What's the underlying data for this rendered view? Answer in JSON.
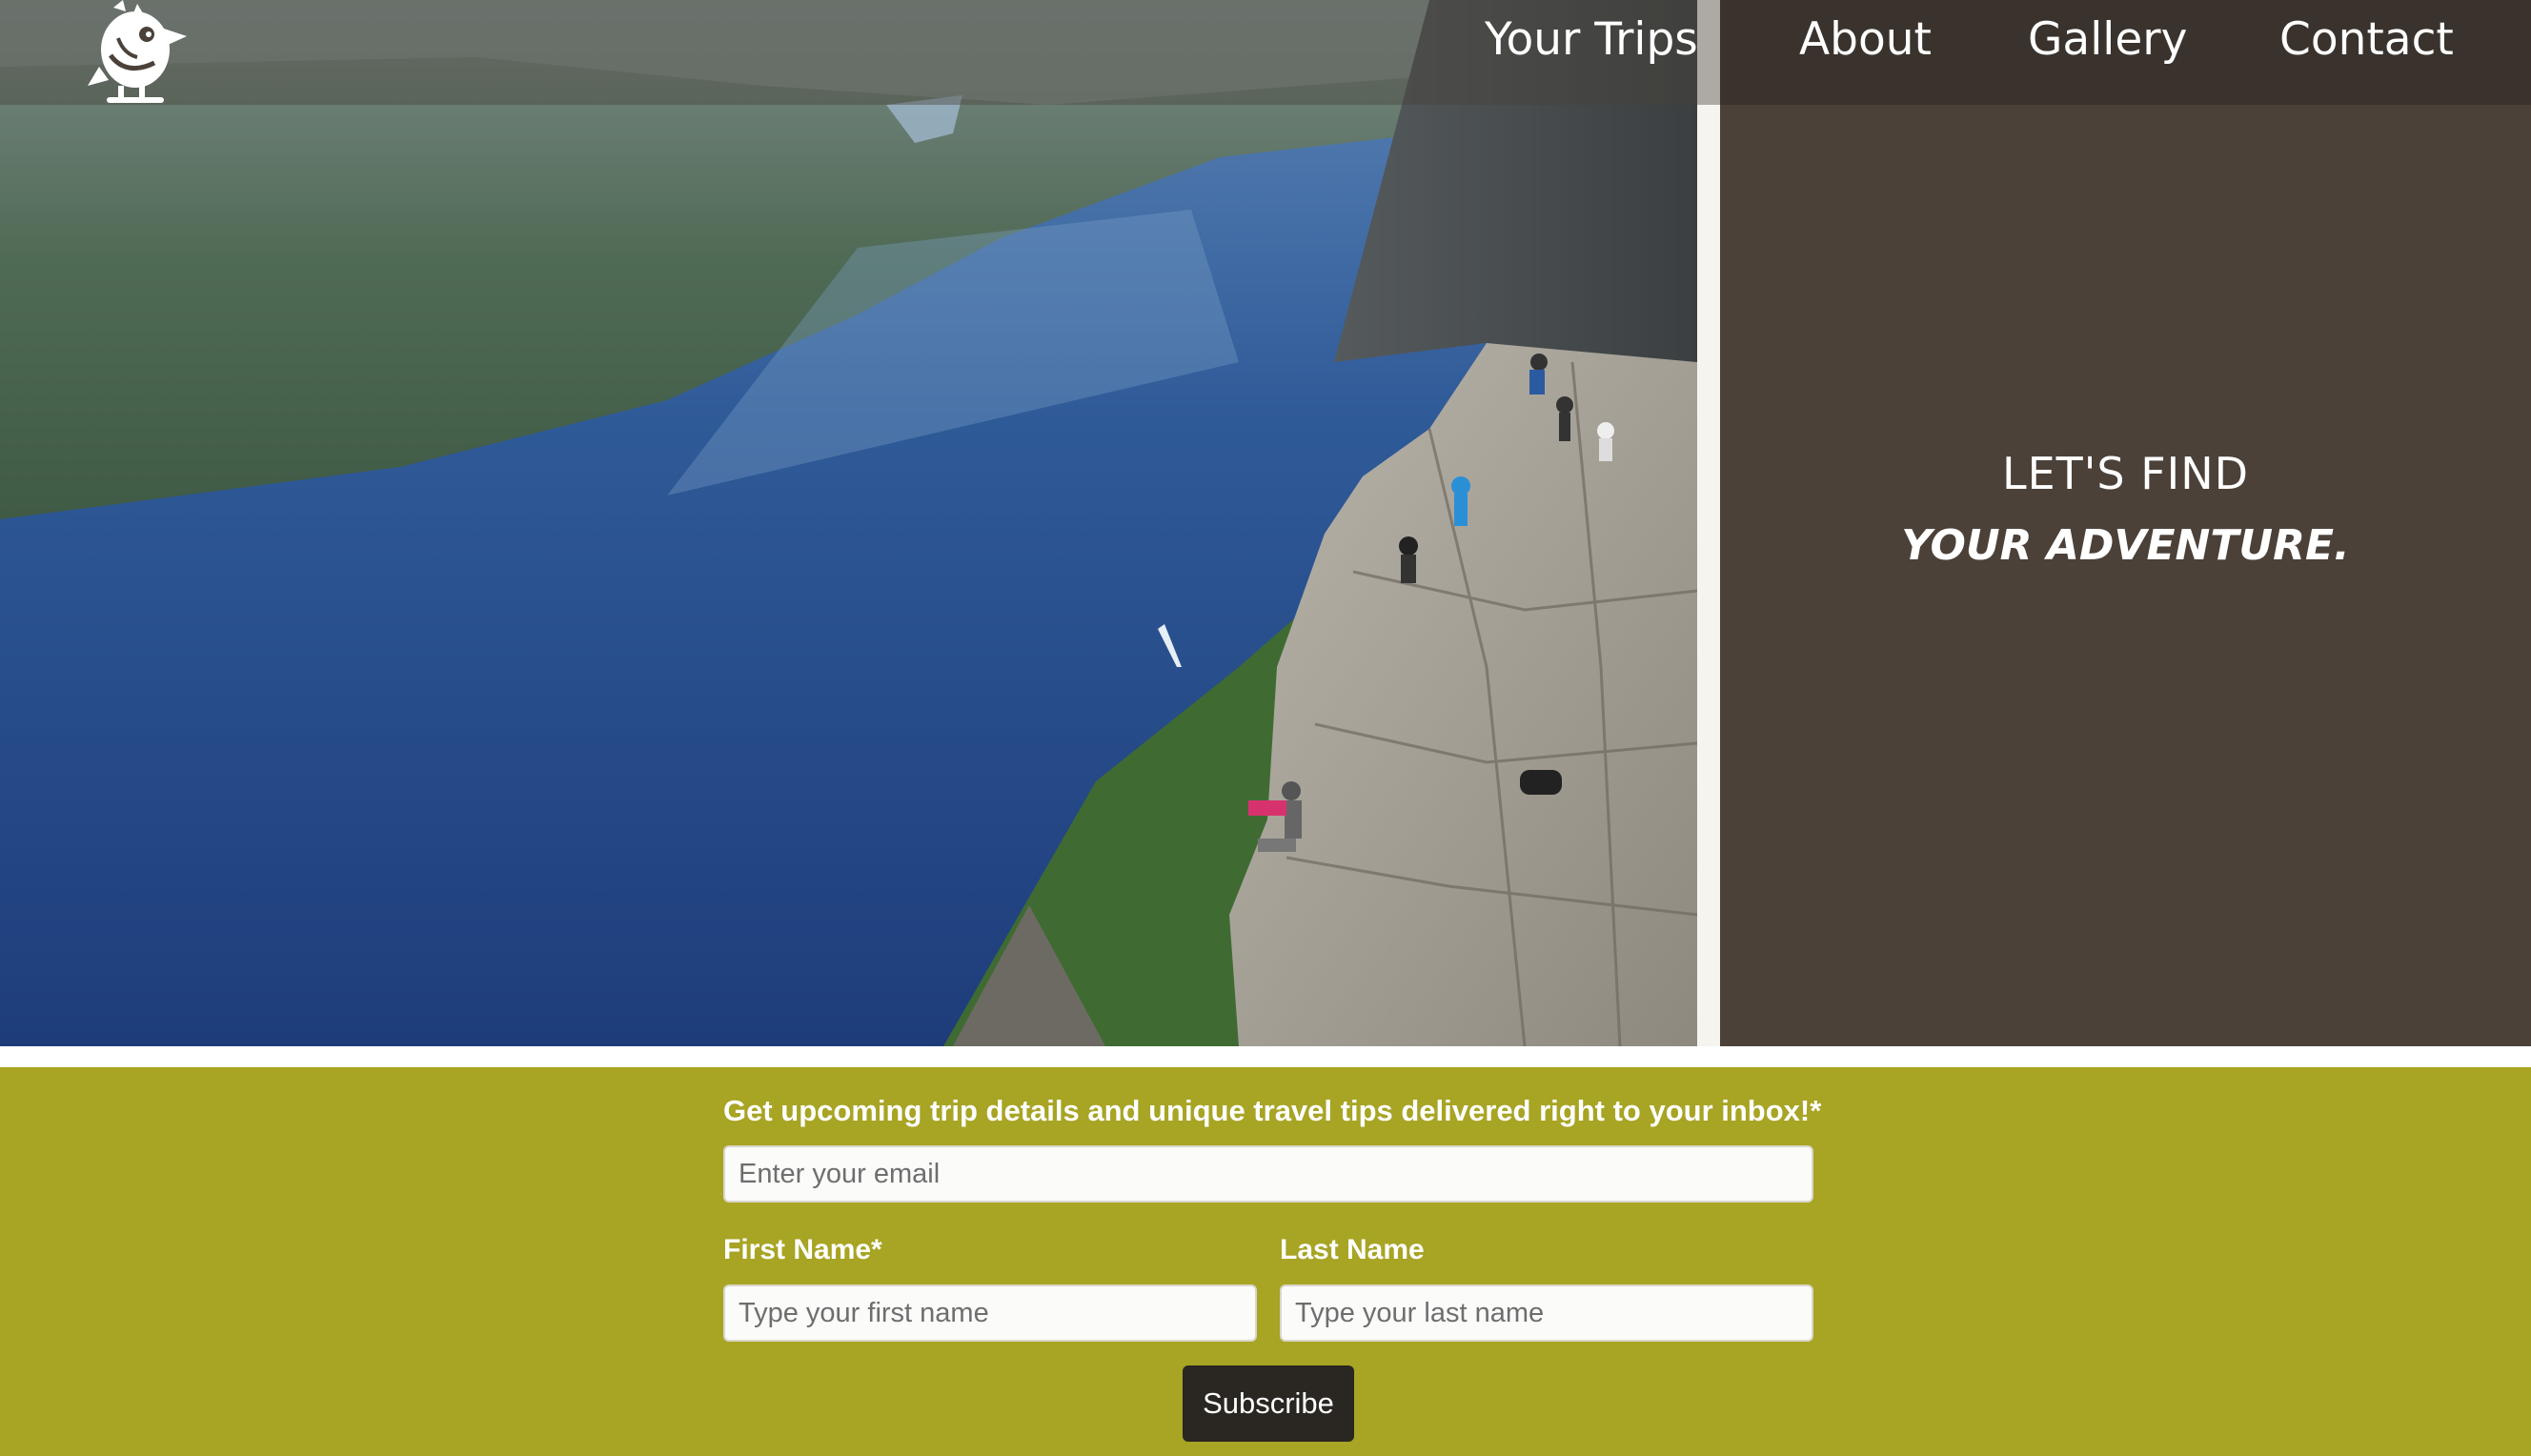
{
  "nav": {
    "items": [
      {
        "label": "Your Trips"
      },
      {
        "label": "About"
      },
      {
        "label": "Gallery"
      },
      {
        "label": "Contact"
      }
    ]
  },
  "logo": {
    "icon": "bird-mascot-icon"
  },
  "hero": {
    "image_subject": "fjord-cliff-photo",
    "tagline_line1": "LET'S FIND",
    "tagline_line2": "YOUR ADVENTURE."
  },
  "newsletter": {
    "title": "Get upcoming trip details and unique travel tips delivered right to your inbox!*",
    "email_placeholder": "Enter your email",
    "first_name_label": "First Name*",
    "first_name_placeholder": "Type your first name",
    "last_name_label": "Last Name",
    "last_name_placeholder": "Type your last name",
    "subscribe_label": "Subscribe"
  },
  "colors": {
    "panel_brown": "#4b4139",
    "header_dark": "#3a332d",
    "newsletter_olive": "#a8a424",
    "button_dark": "#2a2622"
  }
}
